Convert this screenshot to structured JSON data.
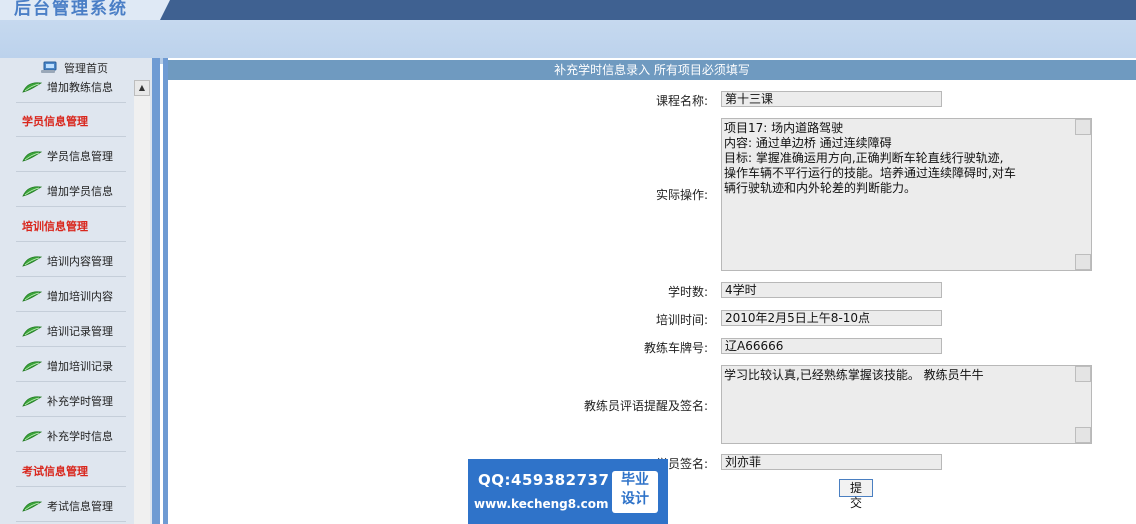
{
  "app": {
    "title": "后台管理系统"
  },
  "sidebar": {
    "home_label": "管理首页",
    "items": [
      {
        "type": "item",
        "label": "增加教练信息"
      },
      {
        "type": "group",
        "label": "学员信息管理"
      },
      {
        "type": "item",
        "label": "学员信息管理"
      },
      {
        "type": "item",
        "label": "增加学员信息"
      },
      {
        "type": "group",
        "label": "培训信息管理"
      },
      {
        "type": "item",
        "label": "培训内容管理"
      },
      {
        "type": "item",
        "label": "增加培训内容"
      },
      {
        "type": "item",
        "label": "培训记录管理"
      },
      {
        "type": "item",
        "label": "增加培训记录"
      },
      {
        "type": "item",
        "label": "补充学时管理"
      },
      {
        "type": "item",
        "label": "补充学时信息"
      },
      {
        "type": "group",
        "label": "考试信息管理"
      },
      {
        "type": "item",
        "label": "考试信息管理"
      }
    ]
  },
  "form": {
    "title": "补充学时信息录入  所有项目必须填写",
    "course_name": {
      "label": "课程名称:",
      "value": "第十三课"
    },
    "practice": {
      "label": "实际操作:",
      "value": "项目17: 场内道路驾驶\n内容: 通过单边桥 通过连续障碍\n目标: 掌握准确运用方向,正确判断车轮直线行驶轨迹,\n操作车辆不平行运行的技能。培养通过连续障碍时,对车\n辆行驶轨迹和内外轮差的判断能力。"
    },
    "hours": {
      "label": "学时数:",
      "value": "4学时"
    },
    "train_time": {
      "label": "培训时间:",
      "value": "2010年2月5日上午8-10点"
    },
    "car_plate": {
      "label": "教练车牌号:",
      "value": "辽A66666"
    },
    "coach_comment": {
      "label": "教练员评语提醒及签名:",
      "value": "学习比较认真,已经熟练掌握该技能。 教练员牛牛"
    },
    "student_sign": {
      "label": "学员签名:",
      "value": "刘亦菲"
    },
    "submit_label": "提交"
  },
  "watermark": {
    "qq": "QQ:459382737",
    "url": "www.kecheng8.com",
    "badge_line1": "毕业",
    "badge_line2": "设计"
  },
  "colors": {
    "accent": "#6f9ac0",
    "group_heading": "#d9261c",
    "watermark_bg": "#2f73c9"
  }
}
